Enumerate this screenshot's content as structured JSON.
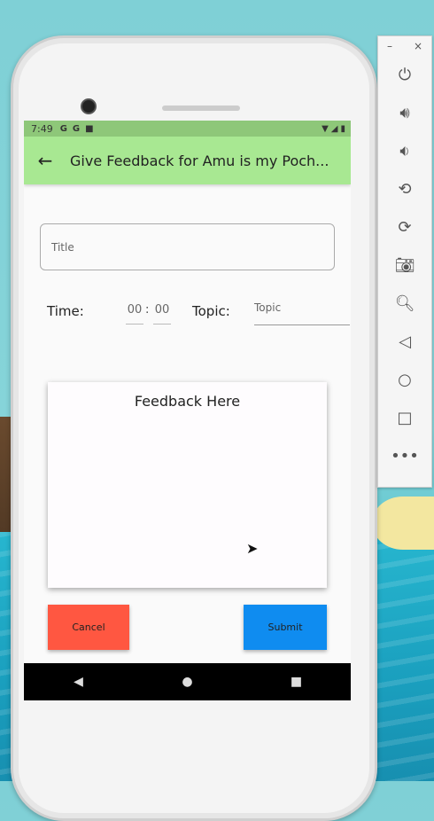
{
  "status_bar": {
    "time": "7:49",
    "icons": [
      "G",
      "G",
      "■"
    ],
    "right_icons": [
      "▼",
      "◢",
      "▮"
    ]
  },
  "app_bar": {
    "back_icon": "arrow-back-icon",
    "title": "Give Feedback for Amu is my Poch..."
  },
  "form": {
    "title_placeholder": "Title",
    "time_label": "Time:",
    "hour": "00",
    "separator": ":",
    "minute": "00",
    "topic_label": "Topic:",
    "topic_placeholder": "Topic",
    "feedback_placeholder": "Feedback Here",
    "cancel_label": "Cancel",
    "submit_label": "Submit"
  },
  "nav_bar": {
    "back": "◀",
    "home": "●",
    "recents": "■"
  },
  "emulator_toolbar": {
    "minimize": "–",
    "close": "×",
    "buttons": [
      "power-icon",
      "volume-up-icon",
      "volume-down-icon",
      "rotate-left-icon",
      "rotate-right-icon",
      "camera-icon",
      "zoom-icon",
      "back-icon",
      "home-icon",
      "overview-icon",
      "more-icon"
    ]
  },
  "colors": {
    "app_bar": "#a8e892",
    "status_bar": "#8ec779",
    "cancel": "#ff5741",
    "submit": "#0f8cf0"
  }
}
